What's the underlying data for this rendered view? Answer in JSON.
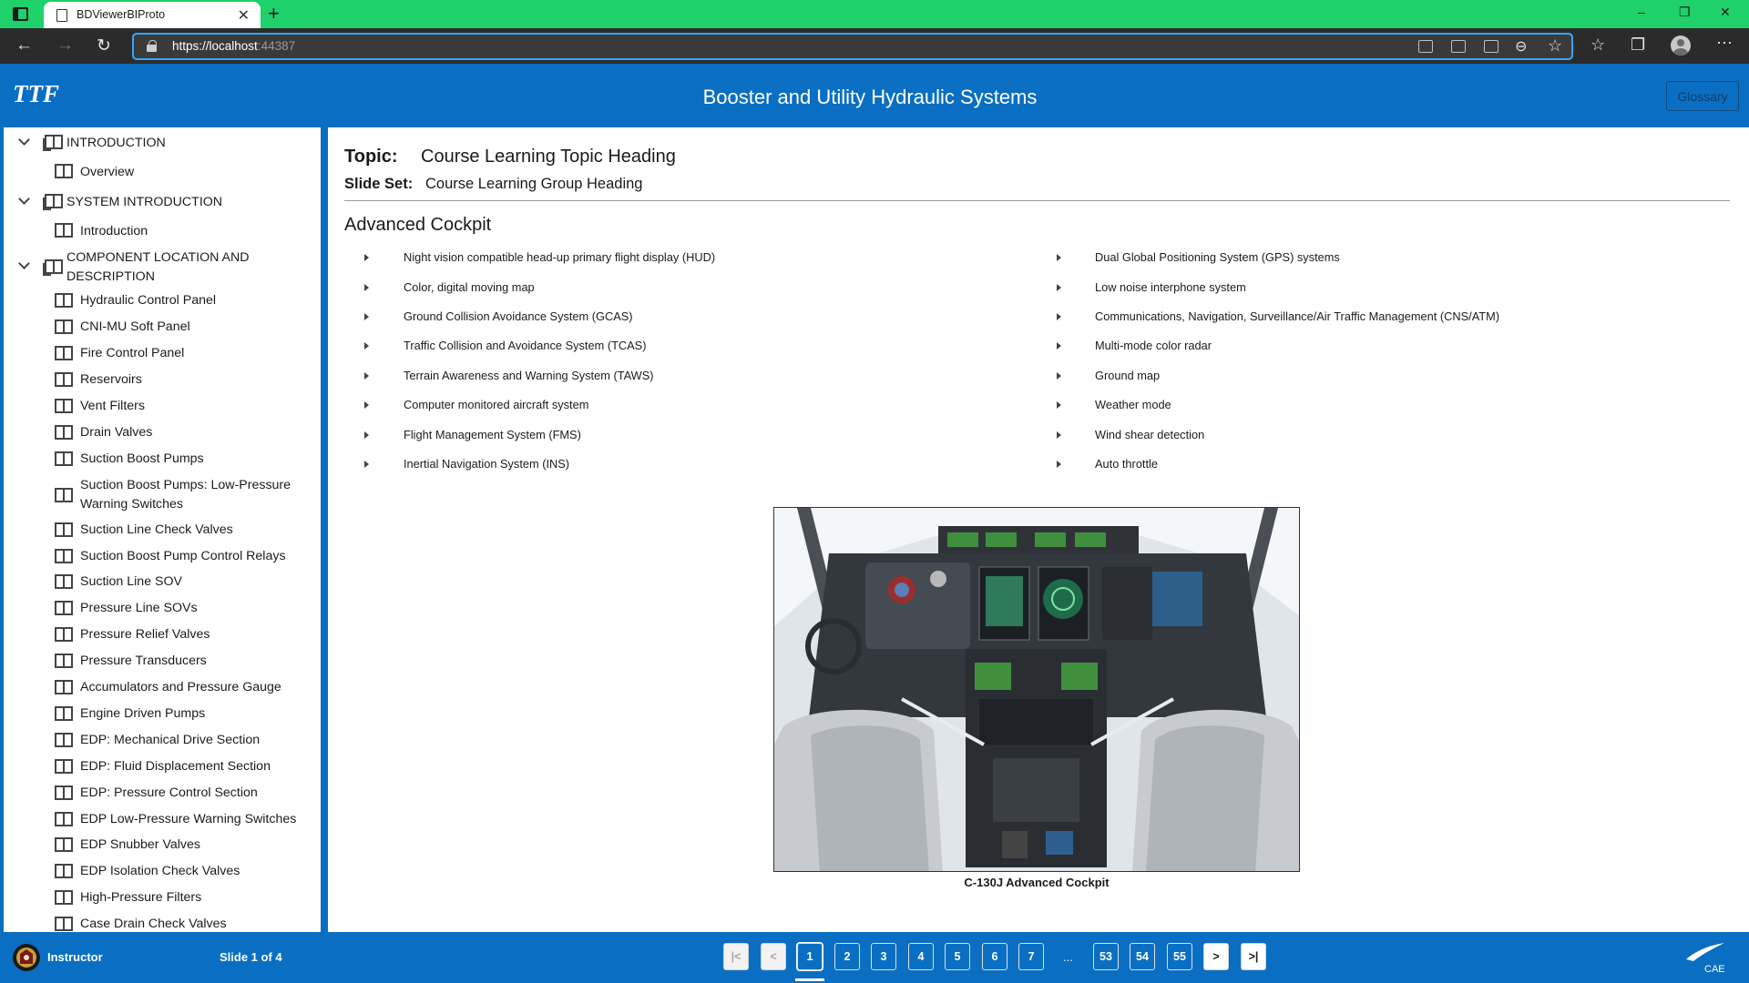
{
  "browser": {
    "tab_title": "BDViewerBIProto",
    "close_glyph": "✕",
    "newtab_glyph": "+",
    "url_host": "https://localhost",
    "url_port": ":44387",
    "window_controls": [
      "–",
      "❐",
      "✕"
    ]
  },
  "header": {
    "logo": "TTF",
    "course_title": "Booster and Utility Hydraulic Systems",
    "glossary_label": "Glossary"
  },
  "sidebar": {
    "sections": [
      {
        "label": "INTRODUCTION",
        "items": [
          "Overview"
        ]
      },
      {
        "label": "SYSTEM INTRODUCTION",
        "items": [
          "Introduction"
        ]
      },
      {
        "label_line1": "COMPONENT LOCATION AND",
        "label_line2": "DESCRIPTION",
        "items": [
          "Hydraulic Control Panel",
          "CNI-MU Soft Panel",
          "Fire Control Panel",
          "Reservoirs",
          "Vent Filters",
          "Drain Valves",
          "Suction Boost Pumps",
          "Suction Boost Pumps: Low-Pressure",
          "Warning Switches",
          "Suction Line Check Valves",
          "Suction Boost Pump Control Relays",
          "Suction Line SOV",
          "Pressure Line SOVs",
          "Pressure Relief Valves",
          "Pressure Transducers",
          "Accumulators and Pressure Gauge",
          "Engine Driven Pumps",
          "EDP: Mechanical Drive Section",
          "EDP: Fluid Displacement Section",
          "EDP: Pressure Control Section",
          "EDP Low-Pressure Warning Switches",
          "EDP Snubber Valves",
          "EDP Isolation Check Valves",
          "High-Pressure Filters",
          "Case Drain Check Valves"
        ]
      }
    ]
  },
  "main": {
    "topic_label": "Topic:",
    "topic_value": "Course Learning Topic Heading",
    "slideset_label": "Slide Set:",
    "slideset_value": "Course Learning Group Heading",
    "slide_title": "Advanced Cockpit",
    "left_bullets": [
      "Night vision compatible head-up primary flight display (HUD)",
      "Color, digital moving map",
      "Ground Collision Avoidance System (GCAS)",
      "Traffic Collision and Avoidance System (TCAS)",
      "Terrain Awareness and Warning System (TAWS)",
      "Computer monitored aircraft system",
      "Flight Management System (FMS)",
      "Inertial Navigation System (INS)"
    ],
    "right_bullets": [
      "Dual Global Positioning System (GPS) systems",
      "Low noise interphone system",
      "Communications, Navigation, Surveillance/Air Traffic Management (CNS/ATM)",
      "Multi-mode color radar",
      "Ground map",
      "Weather mode",
      "Wind shear detection",
      "Auto throttle"
    ],
    "image_caption": "C-130J Advanced Cockpit"
  },
  "footer": {
    "role": "Instructor",
    "slide_counter": "Slide 1 of 4",
    "pages": [
      "1",
      "2",
      "3",
      "4",
      "5",
      "6",
      "7",
      "53",
      "54",
      "55"
    ],
    "ellipsis": "...",
    "current_page": "1",
    "first_glyph": "|<",
    "prev_glyph": "<",
    "next_glyph": ">",
    "last_glyph": ">|",
    "brand": "CAE"
  },
  "colors": {
    "tab_strip": "#1fd16a",
    "brand_blue": "#0a6fc2",
    "address_bar": "#2b2b2b"
  }
}
